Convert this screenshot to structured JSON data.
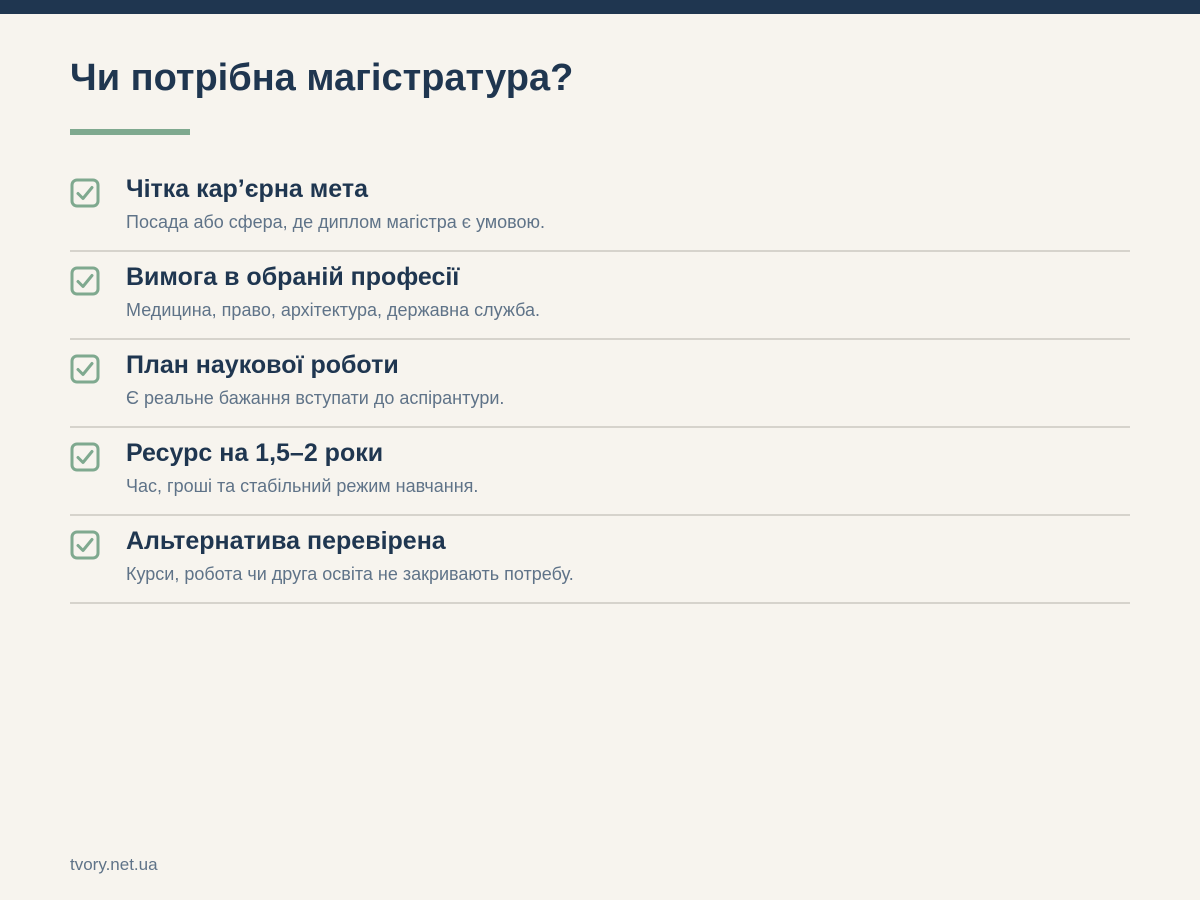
{
  "colors": {
    "navy": "#1f3650",
    "accent": "#7fa98f",
    "muted_text": "#5f7388",
    "divider": "#d6d3cc",
    "background": "#f7f4ee"
  },
  "header": {
    "title": "Чи потрібна магістратура?"
  },
  "checklist": {
    "items": [
      {
        "icon": "check-box-icon",
        "title": "Чітка кар’єрна мета",
        "description": "Посада або сфера, де диплом магістра є умовою."
      },
      {
        "icon": "check-box-icon",
        "title": "Вимога в обраній професії",
        "description": "Медицина, право, архітектура, державна служба."
      },
      {
        "icon": "check-box-icon",
        "title": "План наукової роботи",
        "description": "Є реальне бажання вступати до аспірантури."
      },
      {
        "icon": "check-box-icon",
        "title": "Ресурс на 1,5–2 роки",
        "description": "Час, гроші та стабільний режим навчання."
      },
      {
        "icon": "check-box-icon",
        "title": "Альтернатива перевірена",
        "description": "Курси, робота чи друга освіта не закривають потребу."
      }
    ]
  },
  "footer": {
    "source": "tvory.net.ua"
  }
}
